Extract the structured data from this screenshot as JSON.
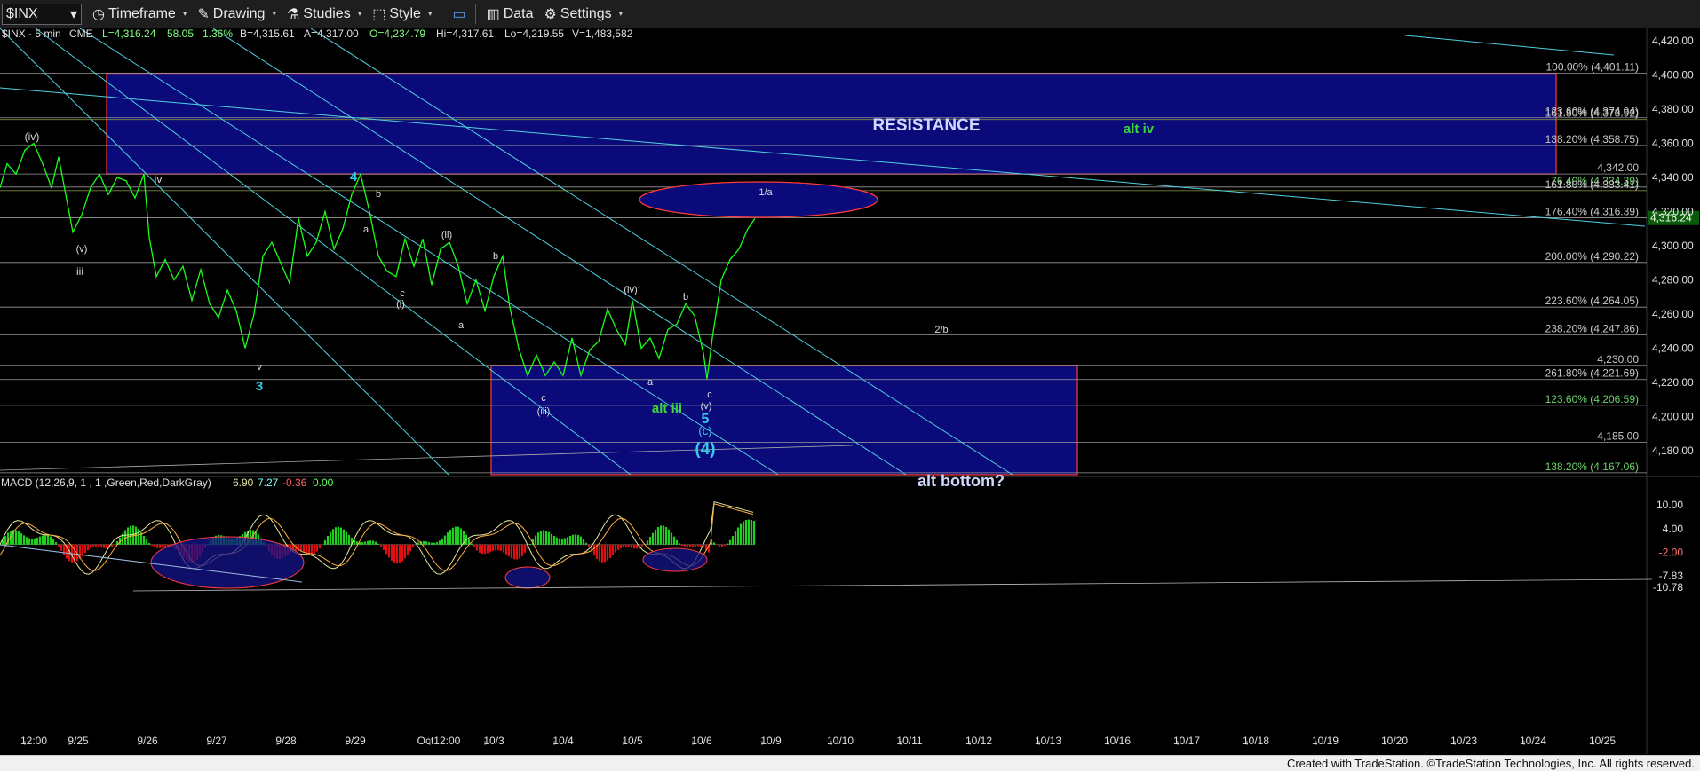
{
  "toolbar": {
    "symbol": "$INX",
    "items": [
      "Timeframe",
      "Drawing",
      "Studies",
      "Style",
      "Data",
      "Settings"
    ]
  },
  "footer": "Created with TradeStation. ©TradeStation Technologies, Inc. All rights reserved.",
  "colors": {
    "price": "#19ff19",
    "zone_fill": "#0a0a7a",
    "zone_border": "#ff3b3b",
    "channel": "#4fd0e0",
    "axis_text": "#e0e0e0"
  },
  "chart_data": {
    "type": "line",
    "header": {
      "symbol": "$INX - 5 min",
      "exchange": "CME",
      "L": "L=4,316.24",
      "chg": "58.05",
      "pct": "1.36%",
      "B": "B=4,315.61",
      "A": "A=4,317.00",
      "O": "O=4,234.79",
      "Hi": "Hi=4,317.61",
      "Lo": "Lo=4,219.55",
      "V": "V=1,483,582"
    },
    "price_ylim": [
      4160,
      4430
    ],
    "price_ticks": [
      "4,420.00",
      "4,400.00",
      "4,380.00",
      "4,360.00",
      "4,340.00",
      "4,320.00",
      "4,300.00",
      "4,280.00",
      "4,260.00",
      "4,240.00",
      "4,220.00",
      "4,200.00",
      "4,180.00"
    ],
    "last_price": "4,316.24",
    "x_ticks": [
      "12:00",
      "9/25",
      "9/26",
      "9/27",
      "9/28",
      "9/29",
      "Oct12:00",
      "10/3",
      "10/4",
      "10/5",
      "10/6",
      "10/9",
      "10/10",
      "10/11",
      "10/12",
      "10/13",
      "10/16",
      "10/17",
      "10/18",
      "10/19",
      "10/20",
      "10/23",
      "10/24",
      "10/25"
    ],
    "price_path": [
      [
        0,
        4334
      ],
      [
        8,
        4348
      ],
      [
        18,
        4342
      ],
      [
        28,
        4356
      ],
      [
        38,
        4360
      ],
      [
        48,
        4348
      ],
      [
        58,
        4334
      ],
      [
        66,
        4352
      ],
      [
        74,
        4330
      ],
      [
        82,
        4308
      ],
      [
        92,
        4318
      ],
      [
        102,
        4334
      ],
      [
        112,
        4342
      ],
      [
        122,
        4330
      ],
      [
        132,
        4340
      ],
      [
        142,
        4338
      ],
      [
        152,
        4328
      ],
      [
        162,
        4342
      ],
      [
        168,
        4305
      ],
      [
        176,
        4282
      ],
      [
        186,
        4292
      ],
      [
        196,
        4280
      ],
      [
        206,
        4288
      ],
      [
        216,
        4268
      ],
      [
        226,
        4286
      ],
      [
        236,
        4266
      ],
      [
        246,
        4258
      ],
      [
        256,
        4274
      ],
      [
        266,
        4262
      ],
      [
        276,
        4240
      ],
      [
        286,
        4260
      ],
      [
        296,
        4294
      ],
      [
        306,
        4302
      ],
      [
        316,
        4290
      ],
      [
        326,
        4278
      ],
      [
        336,
        4316
      ],
      [
        346,
        4294
      ],
      [
        356,
        4302
      ],
      [
        366,
        4320
      ],
      [
        376,
        4298
      ],
      [
        386,
        4310
      ],
      [
        396,
        4330
      ],
      [
        406,
        4342
      ],
      [
        416,
        4320
      ],
      [
        426,
        4294
      ],
      [
        436,
        4285
      ],
      [
        446,
        4282
      ],
      [
        456,
        4304
      ],
      [
        466,
        4288
      ],
      [
        476,
        4304
      ],
      [
        486,
        4277
      ],
      [
        496,
        4298
      ],
      [
        506,
        4302
      ],
      [
        516,
        4288
      ],
      [
        526,
        4266
      ],
      [
        536,
        4280
      ],
      [
        546,
        4262
      ],
      [
        556,
        4282
      ],
      [
        566,
        4294
      ],
      [
        574,
        4264
      ],
      [
        584,
        4240
      ],
      [
        594,
        4224
      ],
      [
        604,
        4236
      ],
      [
        614,
        4224
      ],
      [
        624,
        4232
      ],
      [
        634,
        4224
      ],
      [
        644,
        4246
      ],
      [
        654,
        4224
      ],
      [
        664,
        4239
      ],
      [
        674,
        4244
      ],
      [
        684,
        4263
      ],
      [
        694,
        4251
      ],
      [
        704,
        4242
      ],
      [
        712,
        4268
      ],
      [
        722,
        4240
      ],
      [
        732,
        4246
      ],
      [
        742,
        4234
      ],
      [
        752,
        4251
      ],
      [
        762,
        4254
      ],
      [
        772,
        4266
      ],
      [
        782,
        4259
      ],
      [
        792,
        4237
      ],
      [
        796,
        4222
      ],
      [
        802,
        4246
      ],
      [
        812,
        4280
      ],
      [
        822,
        4292
      ],
      [
        832,
        4298
      ],
      [
        842,
        4310
      ],
      [
        850,
        4316
      ]
    ],
    "levels": [
      {
        "label": "100.00% (4,401.11)",
        "value": 4401.11
      },
      {
        "label": "123.60% (4,374.94)",
        "value": 4374.94
      },
      {
        "label": "161.80% (4,373.92)",
        "value": 4373.92
      },
      {
        "label": "138.20% (4,358.75)",
        "value": 4358.75
      },
      {
        "label": "4,342.00",
        "value": 4342.0
      },
      {
        "label": "76.40% (4,334.39)",
        "value": 4334.39
      },
      {
        "label": "161.80% (4,333.41)",
        "value": 4332.3
      },
      {
        "label": "176.40% (4,316.39)",
        "value": 4316.39
      },
      {
        "label": "200.00% (4,290.22)",
        "value": 4290.22
      },
      {
        "label": "223.60% (4,264.05)",
        "value": 4264.05
      },
      {
        "label": "238.20% (4,247.86)",
        "value": 4247.86
      },
      {
        "label": "4,230.00",
        "value": 4230.0
      },
      {
        "label": "261.80% (4,221.69)",
        "value": 4221.69
      },
      {
        "label": "123.60% (4,206.59)",
        "value": 4206.59
      },
      {
        "label": "4,185.00",
        "value": 4185.0
      },
      {
        "label": "138.20% (4,167.06)",
        "value": 4167.06
      }
    ],
    "zones": [
      {
        "label": "RESISTANCE",
        "top": 4401,
        "bottom": 4342
      },
      {
        "label": "alt bottom?",
        "top": 4230,
        "bottom": 4166
      }
    ],
    "annotations": [
      "(iv)",
      "iv",
      "(v)",
      "iii",
      "v",
      "3",
      "4",
      "b",
      "a",
      "c",
      "(i)",
      "(ii)",
      "a",
      "b",
      "(iii)",
      "c",
      "(iv)",
      "a",
      "b",
      "c",
      "(v)",
      "5",
      "(c)",
      "(4)",
      "alt iii",
      "alt iv",
      "1/a",
      "2/b"
    ],
    "macd": {
      "title": "MACD (12,26,9, 1 , 1 ,Green,Red,DarkGray)",
      "values": [
        "6.90",
        "7.27",
        "-0.36",
        "0.00"
      ],
      "ticks": [
        "10.00",
        "4.00",
        "-2.00",
        "-7.83",
        "-10.78"
      ],
      "ylim": [
        -12,
        14
      ],
      "hist_current": "-0.36",
      "line_current": "6.90",
      "signal_current": "7.27"
    }
  }
}
